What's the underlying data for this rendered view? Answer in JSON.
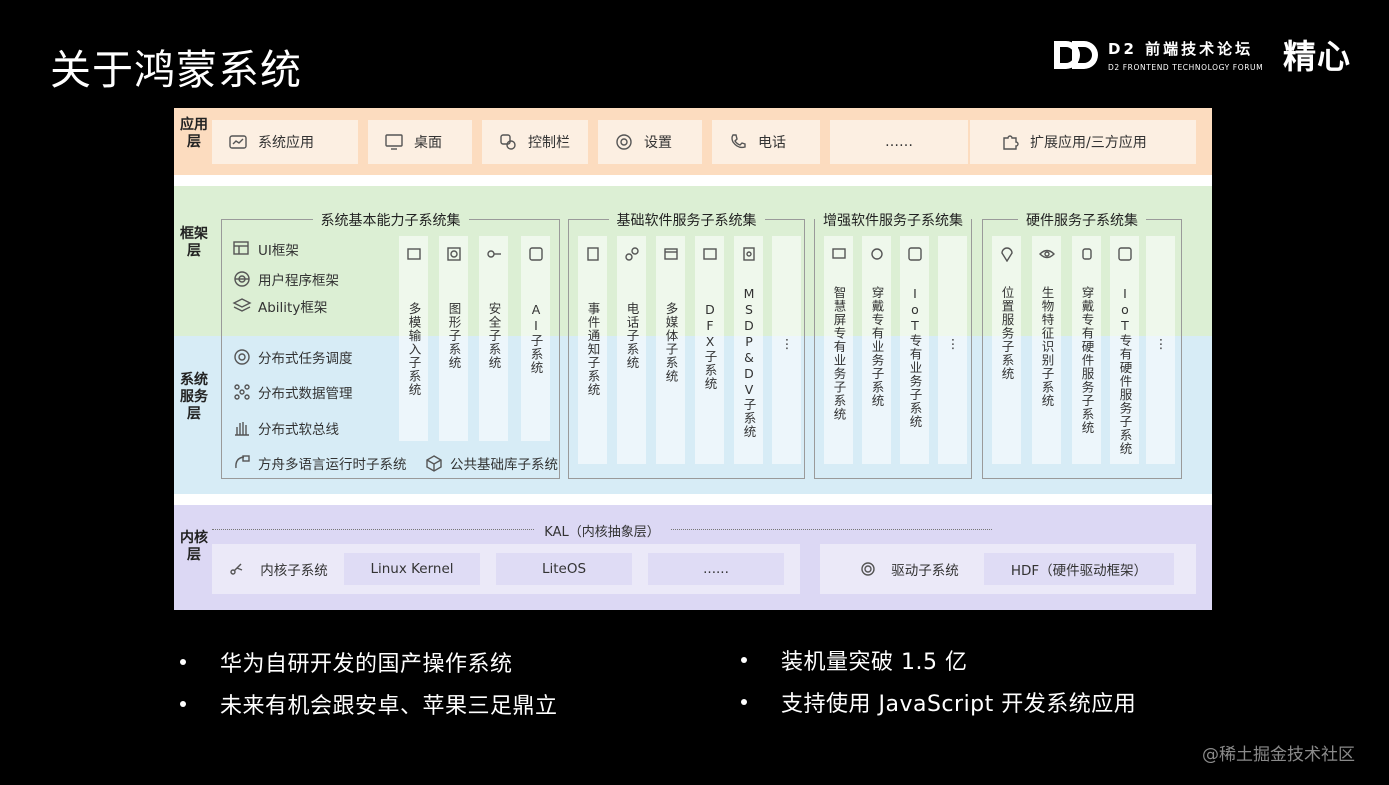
{
  "slide": {
    "title": "关于鸿蒙系统",
    "logo_title": "D2 前端技术论坛",
    "logo_sub": "D2 FRONTEND TECHNOLOGY FORUM",
    "brand": "精心",
    "watermark": "@稀土掘金技术社区"
  },
  "layers": {
    "app": "应用层",
    "framework": "框架层",
    "service": "系统服务层",
    "kernel": "内核层"
  },
  "app_layer": {
    "items": [
      {
        "label": "系统应用",
        "icon": "app-window-icon"
      },
      {
        "label": "桌面",
        "icon": "monitor-icon"
      },
      {
        "label": "控制栏",
        "icon": "control-icon"
      },
      {
        "label": "设置",
        "icon": "gear-icon"
      },
      {
        "label": "电话",
        "icon": "phone-icon"
      },
      {
        "label": "……"
      },
      {
        "label": "扩展应用/三方应用",
        "icon": "puzzle-icon"
      }
    ]
  },
  "groups": {
    "basic": {
      "title": "系统基本能力子系统集",
      "framework_items": [
        "UI框架",
        "用户程序框架",
        "Ability框架"
      ],
      "service_items": [
        "分布式任务调度",
        "分布式数据管理",
        "分布式软总线",
        "方舟多语言运行时子系统",
        "公共基础库子系统"
      ],
      "columns": [
        "多模输入子系统",
        "图形子系统",
        "安全子系统",
        "AI子系统"
      ]
    },
    "foundation": {
      "title": "基础软件服务子系统集",
      "columns": [
        "事件通知子系统",
        "电话子系统",
        "多媒体子系统",
        "DFX子系统",
        "MSDP&DV子系统",
        "⋮"
      ]
    },
    "enhanced": {
      "title": "增强软件服务子系统集",
      "columns": [
        "智慧屏专有业务子系统",
        "穿戴专有业务子系统",
        "IoT专有业务子系统",
        "⋮"
      ]
    },
    "hardware": {
      "title": "硬件服务子系统集",
      "columns": [
        "位置服务子系统",
        "生物特征识别子系统",
        "穿戴专有硬件服务子系统",
        "IoT专有硬件服务子系统",
        "⋮"
      ]
    }
  },
  "kernel_layer": {
    "kal": "KAL（内核抽象层）",
    "left": [
      "内核子系统",
      "Linux Kernel",
      "LiteOS",
      "......"
    ],
    "right": [
      "驱动子系统",
      "HDF（硬件驱动框架）"
    ]
  },
  "bullets": {
    "left": [
      "华为自研开发的国产操作系统",
      "未来有机会跟安卓、苹果三足鼎立"
    ],
    "right": [
      "装机量突破 1.5 亿",
      "支持使用 JavaScript 开发系统应用"
    ]
  }
}
